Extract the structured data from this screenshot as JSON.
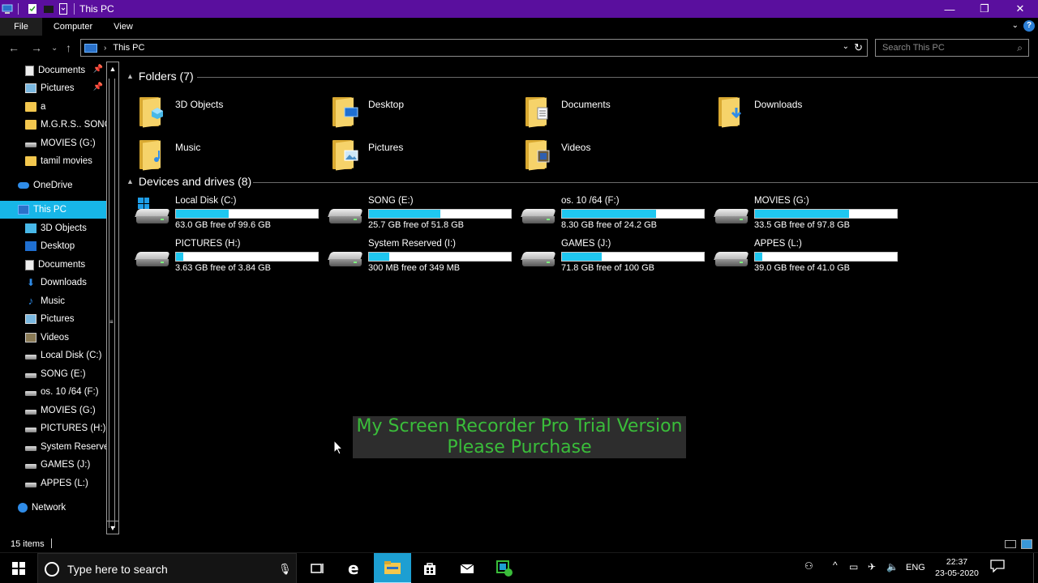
{
  "window": {
    "title": "This PC",
    "minimize": "—",
    "maximize": "❐",
    "close": "✕"
  },
  "ribbon": {
    "tabs": [
      "File",
      "Computer",
      "View"
    ],
    "expand": "⌄",
    "help": "?"
  },
  "address": {
    "back": "←",
    "forward": "→",
    "recent": "⌄",
    "up": "↑",
    "chevron": "›",
    "path": "This PC",
    "dropdown": "⌄",
    "refresh": "↻",
    "search_placeholder": "Search This PC"
  },
  "nav": {
    "items": [
      {
        "label": "Documents",
        "icon": "doc",
        "pinned": true
      },
      {
        "label": "Pictures",
        "icon": "pic",
        "pinned": true
      },
      {
        "label": "a",
        "icon": "folder"
      },
      {
        "label": "M.G.R.S.. SONGS",
        "icon": "folder"
      },
      {
        "label": "MOVIES (G:)",
        "icon": "drive"
      },
      {
        "label": "tamil movies",
        "icon": "folder"
      },
      {
        "label": "OneDrive",
        "icon": "cloud"
      },
      {
        "label": "This PC",
        "icon": "pc",
        "selected": true
      },
      {
        "label": "3D Objects",
        "icon": "3d"
      },
      {
        "label": "Desktop",
        "icon": "desk"
      },
      {
        "label": "Documents",
        "icon": "doc"
      },
      {
        "label": "Downloads",
        "icon": "down"
      },
      {
        "label": "Music",
        "icon": "music"
      },
      {
        "label": "Pictures",
        "icon": "pic"
      },
      {
        "label": "Videos",
        "icon": "vid"
      },
      {
        "label": "Local Disk (C:)",
        "icon": "drive"
      },
      {
        "label": "SONG (E:)",
        "icon": "drive"
      },
      {
        "label": "os. 10  /64 (F:)",
        "icon": "drive"
      },
      {
        "label": "MOVIES (G:)",
        "icon": "drive"
      },
      {
        "label": "PICTURES (H:)",
        "icon": "drive"
      },
      {
        "label": "System Reserved (I:)",
        "icon": "drive"
      },
      {
        "label": "GAMES (J:)",
        "icon": "drive"
      },
      {
        "label": "APPES (L:)",
        "icon": "drive"
      },
      {
        "label": "Network",
        "icon": "net"
      }
    ]
  },
  "folders": {
    "heading": "Folders (7)",
    "items": [
      {
        "label": "3D Objects",
        "badge": "3d"
      },
      {
        "label": "Desktop",
        "badge": "desk"
      },
      {
        "label": "Documents",
        "badge": "doc"
      },
      {
        "label": "Downloads",
        "badge": "down"
      },
      {
        "label": "Music",
        "badge": "music"
      },
      {
        "label": "Pictures",
        "badge": "pic"
      },
      {
        "label": "Videos",
        "badge": "vid"
      }
    ]
  },
  "drives": {
    "heading": "Devices and drives (8)",
    "items": [
      {
        "name": "Local Disk (C:)",
        "free": "63.0 GB free of 99.6 GB",
        "used_fraction": 0.37,
        "system": true
      },
      {
        "name": "SONG (E:)",
        "free": "25.7 GB free of 51.8 GB",
        "used_fraction": 0.5
      },
      {
        "name": "os. 10  /64 (F:)",
        "free": "8.30 GB free of 24.2 GB",
        "used_fraction": 0.66
      },
      {
        "name": "MOVIES (G:)",
        "free": "33.5 GB free of 97.8 GB",
        "used_fraction": 0.66
      },
      {
        "name": "PICTURES (H:)",
        "free": "3.63 GB free of 3.84 GB",
        "used_fraction": 0.05
      },
      {
        "name": "System Reserved (I:)",
        "free": "300 MB free of 349 MB",
        "used_fraction": 0.14
      },
      {
        "name": "GAMES (J:)",
        "free": "71.8 GB free of 100 GB",
        "used_fraction": 0.28
      },
      {
        "name": "APPES (L:)",
        "free": "39.0 GB free of 41.0 GB",
        "used_fraction": 0.05
      }
    ]
  },
  "watermark": {
    "line1": "My Screen Recorder Pro Trial Version",
    "line2": "Please Purchase"
  },
  "status": {
    "count": "15 items"
  },
  "taskbar": {
    "search_placeholder": "Type here to search",
    "language": "ENG",
    "time": "22:37",
    "date": "23-05-2020"
  },
  "colors": {
    "titlebar": "#5a0f9e",
    "selection": "#17b6e8",
    "drive_fill": "#1fc7f0",
    "watermark_text": "#3abd3a"
  }
}
